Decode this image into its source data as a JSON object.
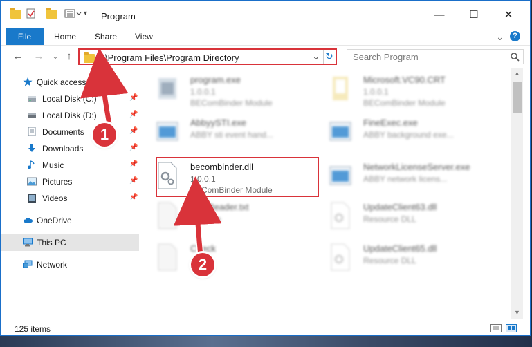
{
  "window": {
    "title": "Program",
    "minimize": "—",
    "maximize": "☐",
    "close": "✕"
  },
  "ribbon": {
    "tabs": [
      "File",
      "Home",
      "Share",
      "View"
    ],
    "expand": "⌄",
    "help": "?"
  },
  "address": {
    "path": "C:\\Program Files\\Program Directory",
    "search_placeholder": "Search Program",
    "dropdown": "⌄",
    "refresh": "↻",
    "back": "←",
    "forward": "→",
    "recent": "⌄",
    "up": "↑"
  },
  "nav": {
    "items": [
      {
        "label": "Quick access",
        "icon": "star-icon"
      },
      {
        "label": "Local Disk (C:)",
        "icon": "drive-icon"
      },
      {
        "label": "Local Disk (D:)",
        "icon": "drive-icon"
      },
      {
        "label": "Documents",
        "icon": "documents-icon"
      },
      {
        "label": "Downloads",
        "icon": "download-icon"
      },
      {
        "label": "Music",
        "icon": "music-icon"
      },
      {
        "label": "Pictures",
        "icon": "pictures-icon"
      },
      {
        "label": "Videos",
        "icon": "videos-icon"
      },
      {
        "label": "OneDrive",
        "icon": "cloud-icon"
      },
      {
        "label": "This PC",
        "icon": "computer-icon"
      },
      {
        "label": "Network",
        "icon": "network-icon"
      }
    ],
    "pin": "📌"
  },
  "files": [
    {
      "name": "program.exe",
      "line1": "1.0.0.1",
      "line2": "BEComBinder Module"
    },
    {
      "name": "Microsoft.VC90.CRT",
      "line1": "1.0.0.1",
      "line2": "BEComBinder Module"
    },
    {
      "name": "AbbyySTI.exe",
      "line1": "ABBY sti event hand...",
      "line2": ""
    },
    {
      "name": "FineExec.exe",
      "line1": "ABBY background exe...",
      "line2": ""
    },
    {
      "name": "becombinder.dll",
      "line1": "1.0.0.1",
      "line2": "BEComBinder Module"
    },
    {
      "name": "NetworkLicenseServer.exe",
      "line1": "ABBY network licens...",
      "line2": ""
    },
    {
      "name": "FineReader.txt",
      "line1": "Text File",
      "line2": ""
    },
    {
      "name": "UpdateClient63.dll",
      "line1": "Resource DLL",
      "line2": ""
    },
    {
      "name": "Check",
      "line1": "",
      "line2": ""
    },
    {
      "name": "UpdateClient65.dll",
      "line1": "Resource DLL",
      "line2": ""
    }
  ],
  "status": {
    "items": "125 items"
  },
  "annotations": {
    "step1": "1",
    "step2": "2"
  },
  "colors": {
    "accent": "#1979ca",
    "highlight": "#d9333a"
  }
}
